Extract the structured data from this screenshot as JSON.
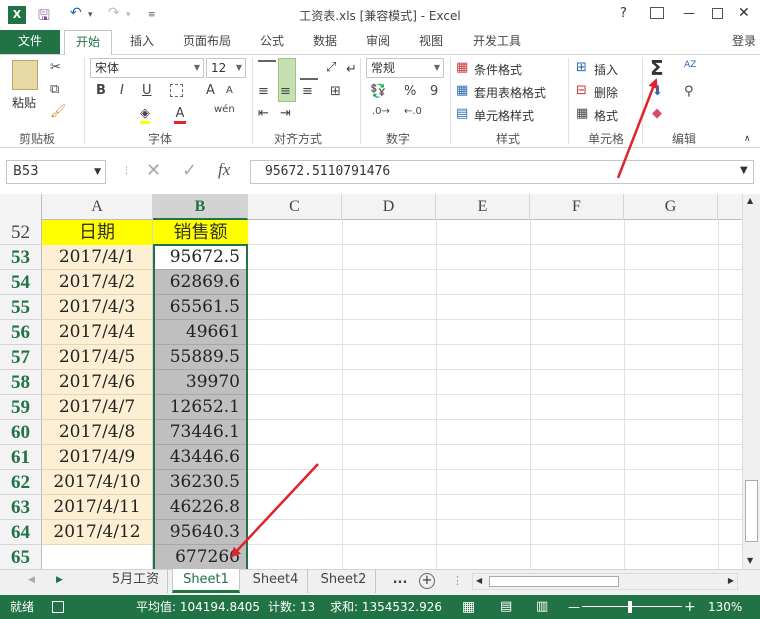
{
  "window": {
    "title": "工资表.xls  [兼容模式] - Excel",
    "help": "?",
    "minimize": "—",
    "close": "✕",
    "login": "登录"
  },
  "tabs": [
    "文件",
    "开始",
    "插入",
    "页面布局",
    "公式",
    "数据",
    "审阅",
    "视图",
    "开发工具"
  ],
  "ribbon": {
    "clipboard": {
      "paste": "粘贴",
      "label": "剪贴板"
    },
    "font": {
      "name": "宋体",
      "size": "12",
      "label": "字体",
      "bold": "B",
      "italic": "I",
      "underline": "U",
      "fontcolor": "A",
      "grow": "A",
      "shrink": "A"
    },
    "align": {
      "label": "对齐方式"
    },
    "number": {
      "format": "常规",
      "percent": "%",
      "comma": "9",
      "label": "数字"
    },
    "styles": {
      "cond": "条件格式",
      "table": "套用表格格式",
      "cell": "单元格样式",
      "label": "样式"
    },
    "cells": {
      "insert": "插入",
      "delete": "删除",
      "format": "格式",
      "label": "单元格"
    },
    "editing": {
      "sum": "Σ",
      "sort": "AZ",
      "find": "🔍",
      "label": "编辑"
    }
  },
  "formula_bar": {
    "namebox": "B53",
    "fx": "fx",
    "value": "95672.5110791476"
  },
  "columns": [
    "A",
    "B",
    "C",
    "D",
    "E",
    "F",
    "G"
  ],
  "header_row": {
    "num": "52",
    "a": "日期",
    "b": "销售额"
  },
  "rows": [
    {
      "num": "53",
      "date": "2017/4/1",
      "sales": "95672.5"
    },
    {
      "num": "54",
      "date": "2017/4/2",
      "sales": "62869.6"
    },
    {
      "num": "55",
      "date": "2017/4/3",
      "sales": "65561.5"
    },
    {
      "num": "56",
      "date": "2017/4/4",
      "sales": "49661"
    },
    {
      "num": "57",
      "date": "2017/4/5",
      "sales": "55889.5"
    },
    {
      "num": "58",
      "date": "2017/4/6",
      "sales": "39970"
    },
    {
      "num": "59",
      "date": "2017/4/7",
      "sales": "12652.1"
    },
    {
      "num": "60",
      "date": "2017/4/8",
      "sales": "73446.1"
    },
    {
      "num": "61",
      "date": "2017/4/9",
      "sales": "43446.6"
    },
    {
      "num": "62",
      "date": "2017/4/10",
      "sales": "36230.5"
    },
    {
      "num": "63",
      "date": "2017/4/11",
      "sales": "46226.8"
    },
    {
      "num": "64",
      "date": "2017/4/12",
      "sales": "95640.3"
    },
    {
      "num": "65",
      "date": "",
      "sales": "677266"
    }
  ],
  "sheets": [
    "5月工资",
    "Sheet1",
    "Sheet4",
    "Sheet2",
    "..."
  ],
  "status": {
    "ready": "就绪",
    "avg": "平均值: 104194.8405",
    "count": "计数: 13",
    "sum": "求和: 1354532.926",
    "zoom": "130%",
    "minus": "—",
    "plus": "+"
  },
  "colors": {
    "excel_green": "#217346",
    "header_yellow": "#ffff00",
    "date_fill": "#fdefd3",
    "selection_gray": "#bfbfbf",
    "arrow_red": "#e0242b"
  }
}
